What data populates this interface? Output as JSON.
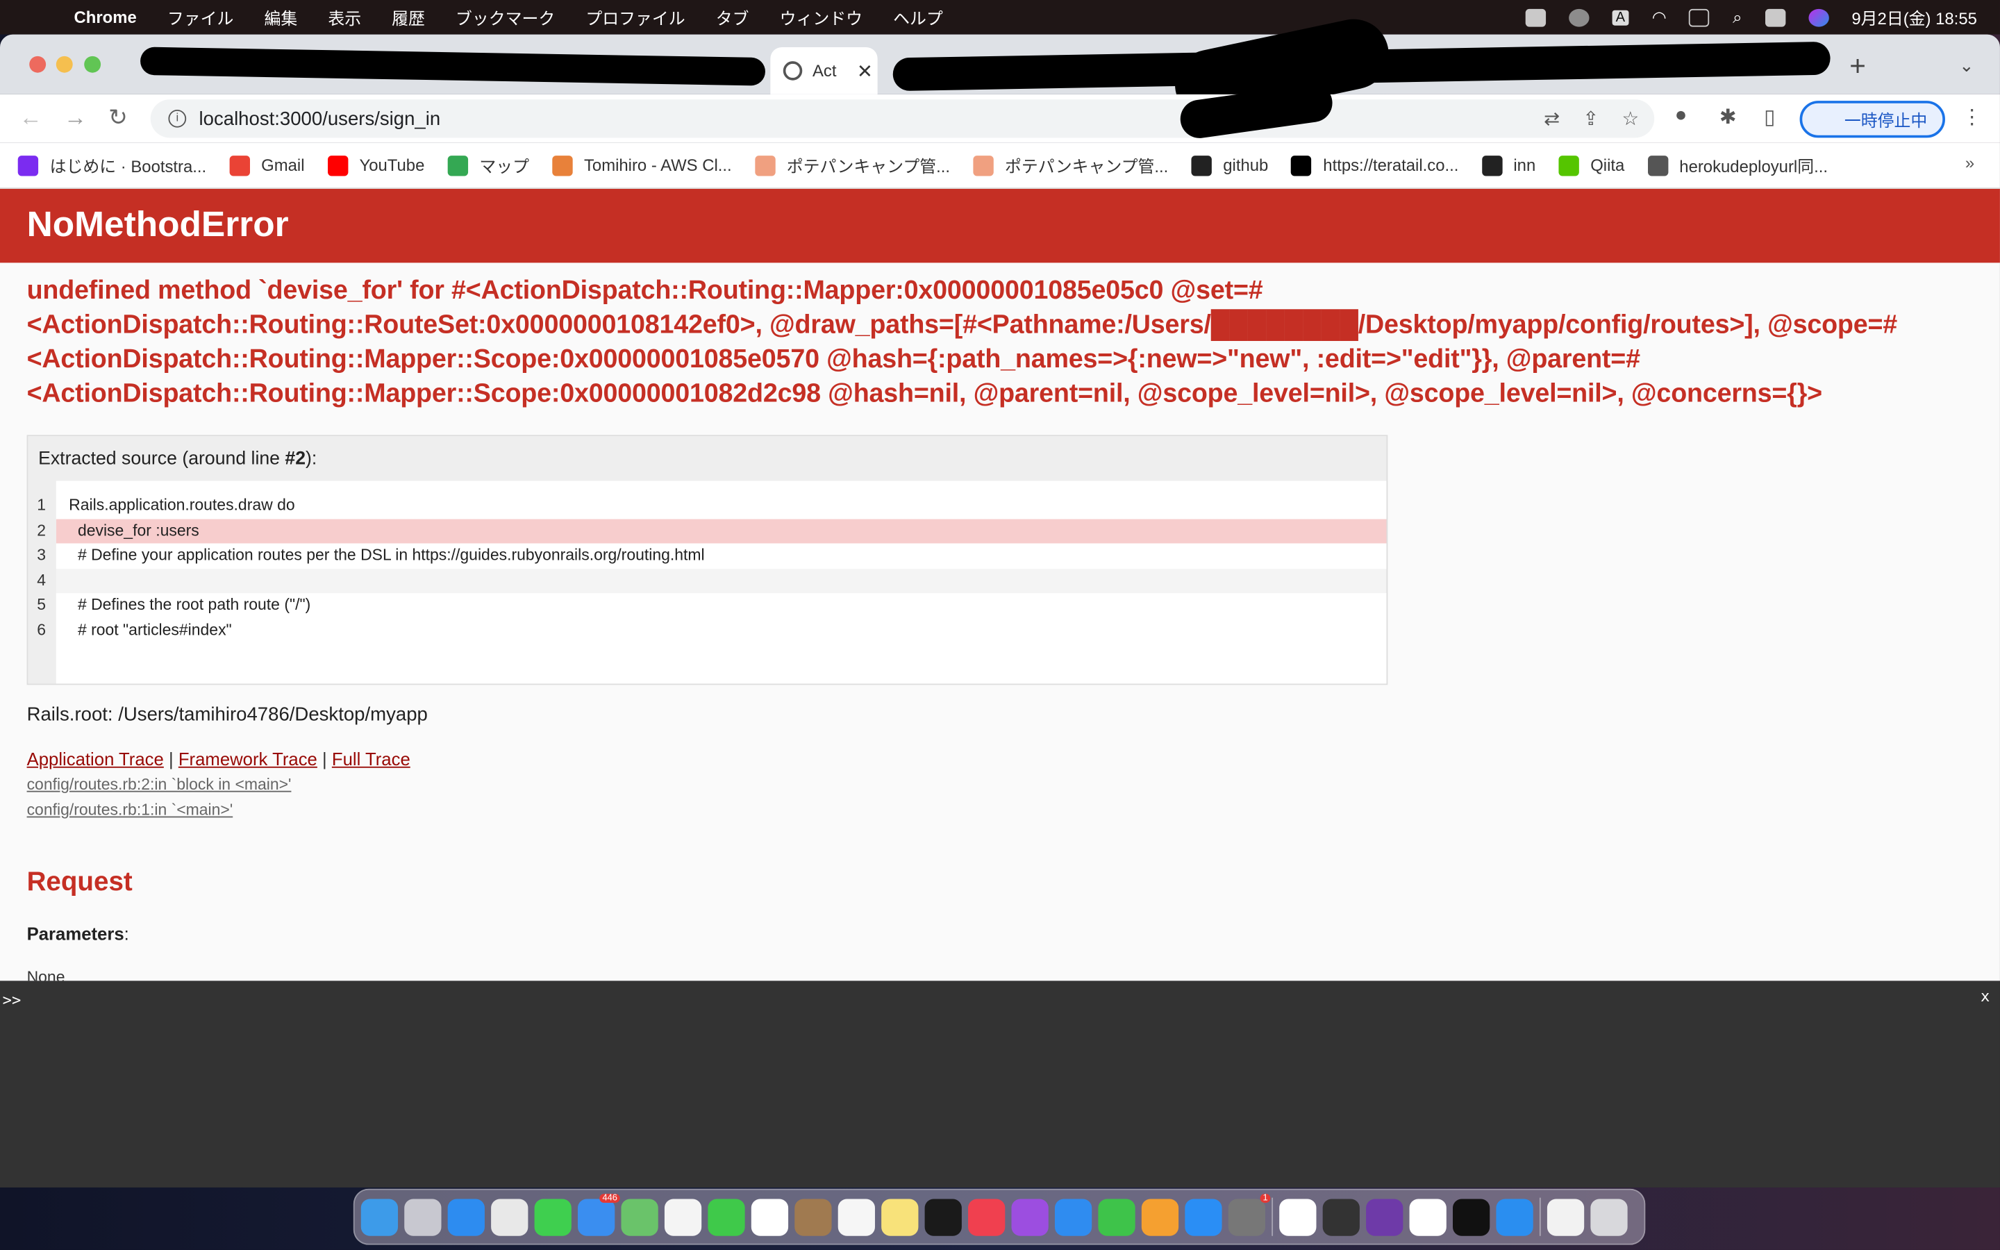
{
  "menubar": {
    "app": "Chrome",
    "items": [
      "ファイル",
      "編集",
      "表示",
      "履歴",
      "ブックマーク",
      "プロファイル",
      "タブ",
      "ウィンドウ",
      "ヘルプ"
    ],
    "input_indicator": "A",
    "datetime": "9月2日(金)  18:55"
  },
  "tabs": {
    "active_title": "Act",
    "new_tab": "+"
  },
  "toolbar": {
    "url": "localhost:3000/users/sign_in",
    "paused_label": "一時停止中"
  },
  "bookmarks": [
    {
      "label": "はじめに · Bootstra...",
      "color": "#7b2cf0"
    },
    {
      "label": "Gmail",
      "color": "#ea4335"
    },
    {
      "label": "YouTube",
      "color": "#ff0000"
    },
    {
      "label": "マップ",
      "color": "#34a853"
    },
    {
      "label": "Tomihiro - AWS Cl...",
      "color": "#e8813a"
    },
    {
      "label": "ポテパンキャンプ管...",
      "color": "#f0a080"
    },
    {
      "label": "ポテパンキャンプ管...",
      "color": "#f0a080"
    },
    {
      "label": "github",
      "color": "#222222"
    },
    {
      "label": "https://teratail.co...",
      "color": "#000000"
    },
    {
      "label": "inn",
      "color": "#222222"
    },
    {
      "label": "Qiita",
      "color": "#55c500"
    },
    {
      "label": "herokudeployurl同...",
      "color": "#555555"
    }
  ],
  "error": {
    "title": "NoMethodError",
    "message": "undefined method `devise_for' for #<ActionDispatch::Routing::Mapper:0x00000001085e05c0 @set=#<ActionDispatch::Routing::RouteSet:0x0000000108142ef0>, @draw_paths=[#<Pathname:/Users/████████/Desktop/myapp/config/routes>], @scope=#<ActionDispatch::Routing::Mapper::Scope:0x00000001085e0570 @hash={:path_names=>{:new=>\"new\", :edit=>\"edit\"}}, @parent=#<ActionDispatch::Routing::Mapper::Scope:0x00000001082d2c98 @hash=nil, @parent=nil, @scope_level=nil>, @scope_level=nil>, @concerns={}>"
  },
  "source": {
    "header_prefix": "Extracted source (around line ",
    "header_line": "#2",
    "header_suffix": "):",
    "lines": [
      {
        "n": "1",
        "code": "Rails.application.routes.draw do"
      },
      {
        "n": "2",
        "code": "  devise_for :users",
        "highlight": true
      },
      {
        "n": "3",
        "code": "  # Define your application routes per the DSL in https://guides.rubyonrails.org/routing.html"
      },
      {
        "n": "4",
        "code": ""
      },
      {
        "n": "5",
        "code": "  # Defines the root path route (\"/\")"
      },
      {
        "n": "6",
        "code": "  # root \"articles#index\""
      }
    ]
  },
  "rails_root": "Rails.root: /Users/tamihiro4786/Desktop/myapp",
  "trace": {
    "application": "Application Trace",
    "framework": "Framework Trace",
    "full": "Full Trace",
    "sep": " | ",
    "frames": [
      "config/routes.rb:2:in `block in <main>'",
      "config/routes.rb:1:in `<main>'"
    ]
  },
  "request": {
    "title": "Request",
    "params_label": "Parameters",
    "params_value": "None"
  },
  "console": {
    "prompt": ">>",
    "close": "x"
  },
  "dock": [
    {
      "name": "finder",
      "color": "#3d9be9"
    },
    {
      "name": "launchpad",
      "color": "#c8c8d0"
    },
    {
      "name": "safari",
      "color": "#2d8cf0"
    },
    {
      "name": "chrome",
      "color": "#e8e8e8"
    },
    {
      "name": "messages",
      "color": "#3fcf4f"
    },
    {
      "name": "mail",
      "color": "#3a8ef0",
      "badge": "446"
    },
    {
      "name": "maps",
      "color": "#6ac36a"
    },
    {
      "name": "photos",
      "color": "#f4f4f4"
    },
    {
      "name": "facetime",
      "color": "#3fc94a"
    },
    {
      "name": "calendar",
      "color": "#ffffff"
    },
    {
      "name": "contacts",
      "color": "#a07a50"
    },
    {
      "name": "reminders",
      "color": "#f6f6f6"
    },
    {
      "name": "notes",
      "color": "#f8e27a"
    },
    {
      "name": "tv",
      "color": "#1a1a1a"
    },
    {
      "name": "music",
      "color": "#f0404f"
    },
    {
      "name": "podcasts",
      "color": "#9c4ee0"
    },
    {
      "name": "keynote",
      "color": "#2f8cf0"
    },
    {
      "name": "numbers",
      "color": "#3ec34a"
    },
    {
      "name": "pages",
      "color": "#f5a030"
    },
    {
      "name": "app-store",
      "color": "#2a8ef5"
    },
    {
      "name": "system-preferences",
      "color": "#777777",
      "badge": "1"
    },
    {
      "sep": true
    },
    {
      "name": "slack",
      "color": "#ffffff"
    },
    {
      "name": "keychain",
      "color": "#333333"
    },
    {
      "name": "github-desktop",
      "color": "#6e3aa8"
    },
    {
      "name": "vscode",
      "color": "#ffffff"
    },
    {
      "name": "terminal",
      "color": "#111111"
    },
    {
      "name": "docker",
      "color": "#2a8ef0"
    },
    {
      "sep": true
    },
    {
      "name": "document",
      "color": "#f2f2f2"
    },
    {
      "name": "trash",
      "color": "#d8d8dc"
    }
  ]
}
